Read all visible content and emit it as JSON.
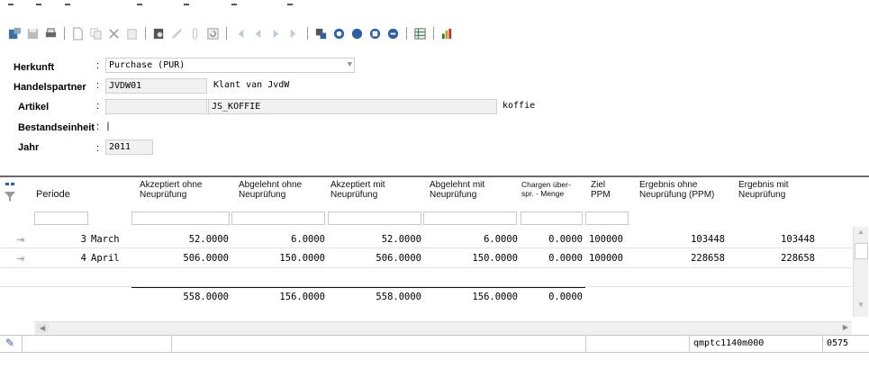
{
  "form": {
    "herkunft": {
      "label": "Herkunft",
      "value": "Purchase (PUR)"
    },
    "handelspartner": {
      "label": "Handelspartner",
      "code": "JVDW01",
      "name": "Klant van JvdW"
    },
    "artikel": {
      "label": "Artikel",
      "value": "JS_KOFFIE",
      "description": "koffie"
    },
    "bestandseinheit": {
      "label": "Bestandseinheit",
      "value": "|"
    },
    "jahr": {
      "label": "Jahr",
      "value": "2011"
    }
  },
  "table": {
    "headers": {
      "periode": "Periode",
      "akz_ohne": "Akzeptiert ohne Neuprüfung",
      "abg_ohne": "Abgelehnt ohne Neuprüfung",
      "akz_mit": "Akzeptiert mit Neuprüfung",
      "abg_mit": "Abgelehnt mit Neuprüfung",
      "chargen": "Chargen über-spr. - Menge",
      "ziel": "Ziel PPM",
      "erg_ohne": "Ergebnis ohne Neuprüfung (PPM)",
      "erg_mit": "Ergebnis mit Neuprüfung"
    },
    "rows": [
      {
        "nr": "3",
        "month": "March",
        "akz_ohne": "52.0000",
        "abg_ohne": "6.0000",
        "akz_mit": "52.0000",
        "abg_mit": "6.0000",
        "chargen": "0.0000",
        "ziel": "100000",
        "erg_ohne": "103448",
        "erg_mit": "103448"
      },
      {
        "nr": "4",
        "month": "April",
        "akz_ohne": "506.0000",
        "abg_ohne": "150.0000",
        "akz_mit": "506.0000",
        "abg_mit": "150.0000",
        "chargen": "0.0000",
        "ziel": "100000",
        "erg_ohne": "228658",
        "erg_mit": "228658"
      }
    ],
    "totals": {
      "akz_ohne": "558.0000",
      "abg_ohne": "156.0000",
      "akz_mit": "558.0000",
      "abg_mit": "156.0000",
      "chargen": "0.0000"
    }
  },
  "status": {
    "session": "qmptc1140m000",
    "code": "0575"
  },
  "icons": [
    "save-icon",
    "print-icon",
    "new-icon",
    "copy-icon",
    "delete-icon",
    "paste-icon",
    "print-preview-icon",
    "edit-icon",
    "attach-icon",
    "refresh-icon",
    "first-icon",
    "prev-icon",
    "next-icon",
    "last-icon",
    "find-icon",
    "zoom-icon",
    "nav-icon",
    "nav2-icon",
    "nav3-icon",
    "grid-icon",
    "chart-icon"
  ]
}
